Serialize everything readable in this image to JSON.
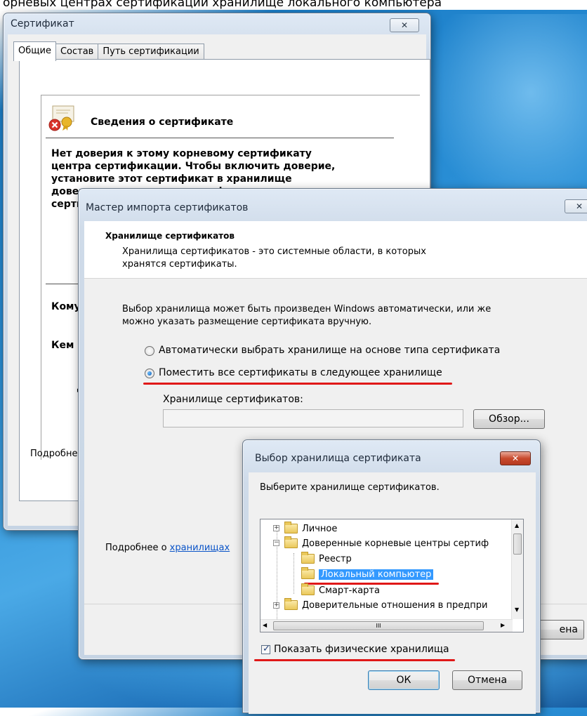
{
  "banner_text": "орневых центрах сертификации хранилище локального компьютера",
  "cert_window": {
    "title": "Сертификат",
    "close_label": "✕",
    "tabs": [
      "Общие",
      "Состав",
      "Путь сертификации"
    ],
    "info_heading": "Сведения о сертификате",
    "warning_lines": [
      "Нет доверия к этому корневому сертификату",
      "центра сертификации. Чтобы включить  доверие,",
      "установите этот сертификат в хранилище",
      "доверенных корневых сертификатов центров",
      "серти"
    ],
    "issued_to_label": "Кому",
    "issued_by_label": "Кем в",
    "partial_letter": "Д",
    "more_label": "Подробне"
  },
  "wizard": {
    "title": "Мастер импорта сертификатов",
    "close_label": "✕",
    "section_title": "Хранилище сертификатов",
    "section_desc_1": "Хранилища сертификатов - это системные области, в которых",
    "section_desc_2": "хранятся сертификаты.",
    "intro_1": "Выбор хранилища может быть произведен Windows автоматически, или же",
    "intro_2": "можно указать размещение сертификата вручную.",
    "radio_auto": "Автоматически выбрать хранилище на основе типа сертификата",
    "radio_manual": "Поместить все сертификаты в следующее хранилище",
    "store_label": "Хранилище сертификатов:",
    "store_value": "",
    "browse_button": "Обзор...",
    "more_prefix": "Подробнее о ",
    "more_link": "хранилищах",
    "cancel_partial": "ена"
  },
  "store_dialog": {
    "title": "Выбор хранилища сертификата",
    "close_label": "✕",
    "prompt": "Выберите хранилище сертификатов.",
    "tree": [
      {
        "label": "Личное"
      },
      {
        "label": "Доверенные корневые центры сертиф"
      },
      {
        "label": "Реестр"
      },
      {
        "label": "Локальный компьютер"
      },
      {
        "label": "Смарт-карта"
      },
      {
        "label": "Доверительные отношения в предпри"
      }
    ],
    "scroll_thumb_label": "III",
    "show_physical_label": "Показать физические хранилища",
    "ok_button": "ОК",
    "cancel_button": "Отмена"
  }
}
